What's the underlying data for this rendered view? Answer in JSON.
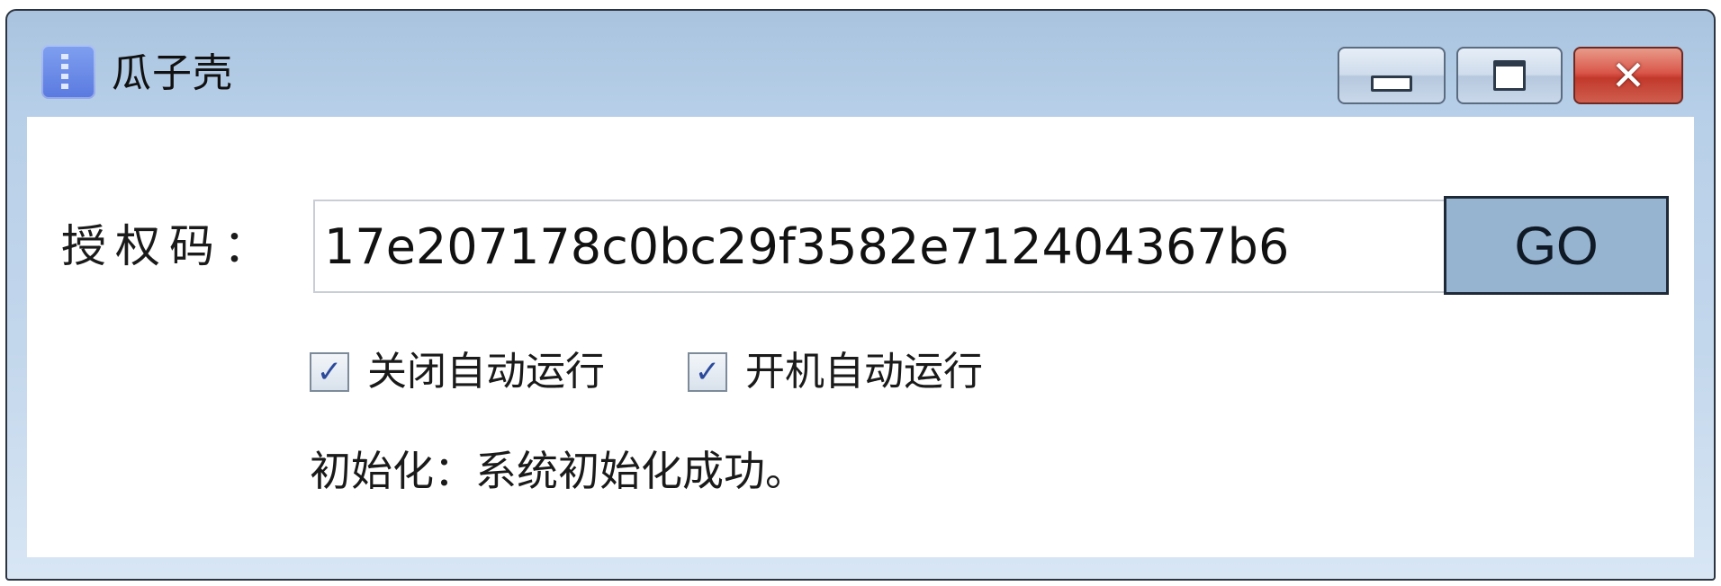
{
  "window": {
    "title": "瓜子壳",
    "icon": "zipper-app-icon",
    "controls": {
      "minimize_icon": "minimize-icon",
      "maximize_icon": "maximize-icon",
      "close_icon": "close-icon",
      "close_glyph": "✕"
    },
    "colors": {
      "go_button": "#96b3d0",
      "close_button": "#c2392b"
    }
  },
  "form": {
    "label": "授权码：",
    "code_value": "17e207178c0bc29f3582e712404367b6",
    "go_label": "GO",
    "options": [
      {
        "label": "关闭自动运行",
        "checked": true
      },
      {
        "label": "开机自动运行",
        "checked": true
      }
    ],
    "check_glyph": "✓",
    "status": "初始化：系统初始化成功。"
  }
}
